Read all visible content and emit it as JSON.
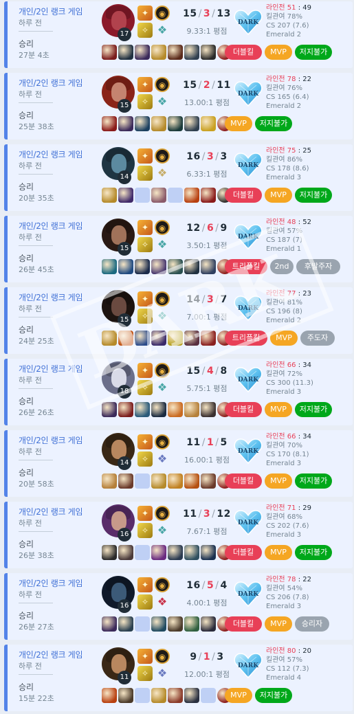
{
  "matches": [
    {
      "queue": "개인/2인 랭크 게임",
      "ago": "하루 전",
      "result": "승리",
      "duration": "27분 4초",
      "level": "17",
      "kills": "15",
      "deaths": "3",
      "assists": "13",
      "ratio": "9.33:1 평점",
      "lane_label": "라인전",
      "lane_a": "51",
      "lane_b": "49",
      "kp": "킬관여 78%",
      "cs": "CS 207 (7.6)",
      "rank": "Emerald 2",
      "badges": [
        "더블킬",
        "MVP",
        "저지불가"
      ],
      "champ_color": "#b1424d",
      "hair_color": "#8b1a2a"
    },
    {
      "queue": "개인/2인 랭크 게임",
      "ago": "하루 전",
      "result": "승리",
      "duration": "25분 38초",
      "level": "15",
      "kills": "15",
      "deaths": "2",
      "assists": "11",
      "ratio": "13.00:1 평점",
      "lane_label": "라인전",
      "lane_a": "78",
      "lane_b": "22",
      "kp": "킬관여 76%",
      "cs": "CS 165 (6.4)",
      "rank": "Emerald 2",
      "badges": [
        "MVP",
        "저지불가"
      ],
      "champ_color": "#c58470",
      "hair_color": "#8a2418"
    },
    {
      "queue": "개인/2인 랭크 게임",
      "ago": "하루 전",
      "result": "승리",
      "duration": "20분 35초",
      "level": "14",
      "kills": "16",
      "deaths": "3",
      "assists": "3",
      "ratio": "6.33:1 평점",
      "lane_label": "라인전",
      "lane_a": "75",
      "lane_b": "25",
      "kp": "킬관여 86%",
      "cs": "CS 178 (8.6)",
      "rank": "Emerald 3",
      "badges": [
        "더블킬",
        "MVP",
        "저지불가"
      ],
      "champ_color": "#5c8aa0",
      "hair_color": "#1f3542"
    },
    {
      "queue": "개인/2인 랭크 게임",
      "ago": "하루 전",
      "result": "승리",
      "duration": "26분 45초",
      "level": "15",
      "kills": "12",
      "deaths": "6",
      "assists": "9",
      "ratio": "3.50:1 평점",
      "lane_label": "라인전",
      "lane_a": "48",
      "lane_b": "52",
      "kp": "킬관여 57%",
      "cs": "CS 187 (7)",
      "rank": "Emerald 1",
      "badges": [
        "트리플킬",
        "2nd",
        "후발주자"
      ],
      "champ_color": "#a0725a",
      "hair_color": "#2a1a14"
    },
    {
      "queue": "개인/2인 랭크 게임",
      "ago": "하루 전",
      "result": "승리",
      "duration": "24분 25초",
      "level": "15",
      "kills": "14",
      "deaths": "3",
      "assists": "7",
      "ratio": "7.00:1 평점",
      "lane_label": "라인전",
      "lane_a": "77",
      "lane_b": "23",
      "kp": "킬관여 81%",
      "cs": "CS 196 (8)",
      "rank": "Emerald 2",
      "badges": [
        "트리플킬",
        "MVP",
        "주도자"
      ],
      "champ_color": "#6a4a40",
      "hair_color": "#1d1410"
    },
    {
      "queue": "개인/2인 랭크 게임",
      "ago": "하루 전",
      "result": "승리",
      "duration": "26분 26초",
      "level": "18",
      "kills": "15",
      "deaths": "4",
      "assists": "8",
      "ratio": "5.75:1 평점",
      "lane_label": "라인전",
      "lane_a": "66",
      "lane_b": "34",
      "kp": "킬관여 72%",
      "cs": "CS 300 (11.3)",
      "rank": "Emerald 3",
      "badges": [
        "더블킬",
        "MVP",
        "저지불가"
      ],
      "champ_color": "#d9dbe8",
      "hair_color": "#6b6f8a"
    },
    {
      "queue": "개인/2인 랭크 게임",
      "ago": "하루 전",
      "result": "승리",
      "duration": "20분 58초",
      "level": "14",
      "kills": "11",
      "deaths": "1",
      "assists": "5",
      "ratio": "16.00:1 평점",
      "lane_label": "라인전",
      "lane_a": "66",
      "lane_b": "34",
      "kp": "킬관여 70%",
      "cs": "CS 170 (8.1)",
      "rank": "Emerald 3",
      "badges": [
        "더블킬",
        "MVP",
        "저지불가"
      ],
      "champ_color": "#b8875f",
      "hair_color": "#3a2816"
    },
    {
      "queue": "개인/2인 랭크 게임",
      "ago": "하루 전",
      "result": "승리",
      "duration": "26분 38초",
      "level": "16",
      "kills": "11",
      "deaths": "3",
      "assists": "12",
      "ratio": "7.67:1 평점",
      "lane_label": "라인전",
      "lane_a": "71",
      "lane_b": "29",
      "kp": "킬관여 68%",
      "cs": "CS 202 (7.6)",
      "rank": "Emerald 3",
      "badges": [
        "더블킬",
        "MVP",
        "저지불가"
      ],
      "champ_color": "#c79a8a",
      "hair_color": "#5a2d6a"
    },
    {
      "queue": "개인/2인 랭크 게임",
      "ago": "하루 전",
      "result": "승리",
      "duration": "26분 27초",
      "level": "16",
      "kills": "16",
      "deaths": "5",
      "assists": "4",
      "ratio": "4.00:1 평점",
      "lane_label": "라인전",
      "lane_a": "78",
      "lane_b": "22",
      "kp": "킬관여 54%",
      "cs": "CS 206 (7.8)",
      "rank": "Emerald 3",
      "badges": [
        "더블킬",
        "MVP",
        "승리자"
      ],
      "champ_color": "#3c5a78",
      "hair_color": "#101a2a"
    },
    {
      "queue": "개인/2인 랭크 게임",
      "ago": "하루 전",
      "result": "승리",
      "duration": "15분 22초",
      "level": "11",
      "kills": "9",
      "deaths": "1",
      "assists": "3",
      "ratio": "12.00:1 평점",
      "lane_label": "라인전",
      "lane_a": "80",
      "lane_b": "20",
      "kp": "킬관여 57%",
      "cs": "CS 112 (7.3)",
      "rank": "Emerald 4",
      "badges": [
        "MVP",
        "저지불가"
      ],
      "champ_color": "#b8875f",
      "hair_color": "#3a2816"
    }
  ],
  "icons": {
    "spell_1": "flash-spell-icon",
    "spell_2": "ignite-spell-icon",
    "heart": "heart-emblem-icon"
  },
  "heart_label": "DARK",
  "watermark_text": "DARK",
  "colors": {
    "accent": "#5383e8",
    "death": "#e84057",
    "mvp": "#f5a623",
    "unstoppable": "#00a81a",
    "gray_badge": "#9aa4af"
  }
}
